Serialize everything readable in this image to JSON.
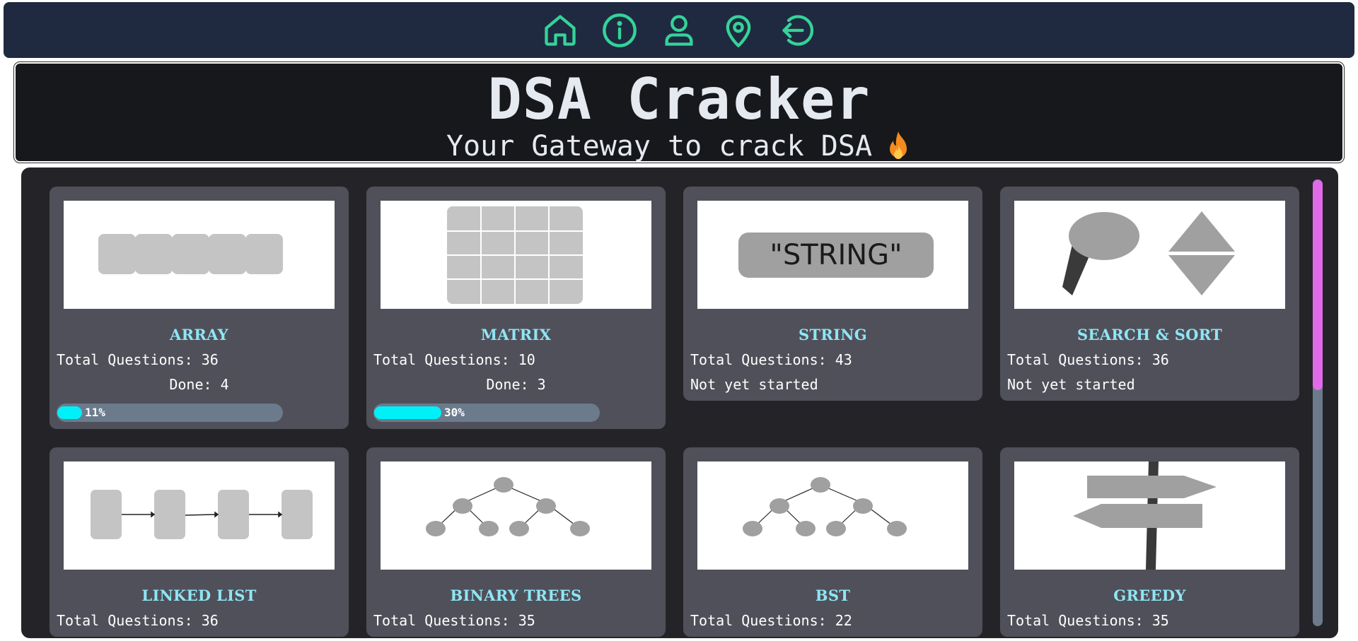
{
  "nav": {
    "icons": [
      "home-icon",
      "info-icon",
      "user-icon",
      "location-pin-icon",
      "logout-icon"
    ],
    "icon_color": "#34d399"
  },
  "header": {
    "title": "DSA Cracker",
    "subtitle": "Your Gateway to crack DSA",
    "subtitle_icon": "fire-icon"
  },
  "cards": [
    {
      "title": "ARRAY",
      "total": "Total Questions: 36",
      "status": "Done: 4",
      "progress_label": "11%",
      "progress": 0.11,
      "started": true,
      "thumb": "array"
    },
    {
      "title": "MATRIX",
      "total": "Total Questions: 10",
      "status": "Done: 3",
      "progress_label": "30%",
      "progress": 0.3,
      "started": true,
      "thumb": "matrix"
    },
    {
      "title": "STRING",
      "total": "Total Questions: 43",
      "status": "Not yet started",
      "started": false,
      "thumb": "string",
      "thumb_text": "\"STRING\""
    },
    {
      "title": "SEARCH & SORT",
      "total": "Total Questions: 36",
      "status": "Not yet started",
      "started": false,
      "thumb": "search"
    },
    {
      "title": "LINKED LIST",
      "total": "Total Questions: 36",
      "started": false,
      "thumb": "linkedlist"
    },
    {
      "title": "BINARY TREES",
      "total": "Total Questions: 35",
      "started": false,
      "thumb": "tree"
    },
    {
      "title": "BST",
      "total": "Total Questions: 22",
      "started": false,
      "thumb": "tree"
    },
    {
      "title": "GREEDY",
      "total": "Total Questions: 35",
      "started": false,
      "thumb": "greedy"
    }
  ],
  "colors": {
    "navbar": "#1f2a40",
    "title_accent": "#8ee6f4",
    "progress_fill": "#00f0f8",
    "scroll_thumb": "#e06ae8"
  }
}
